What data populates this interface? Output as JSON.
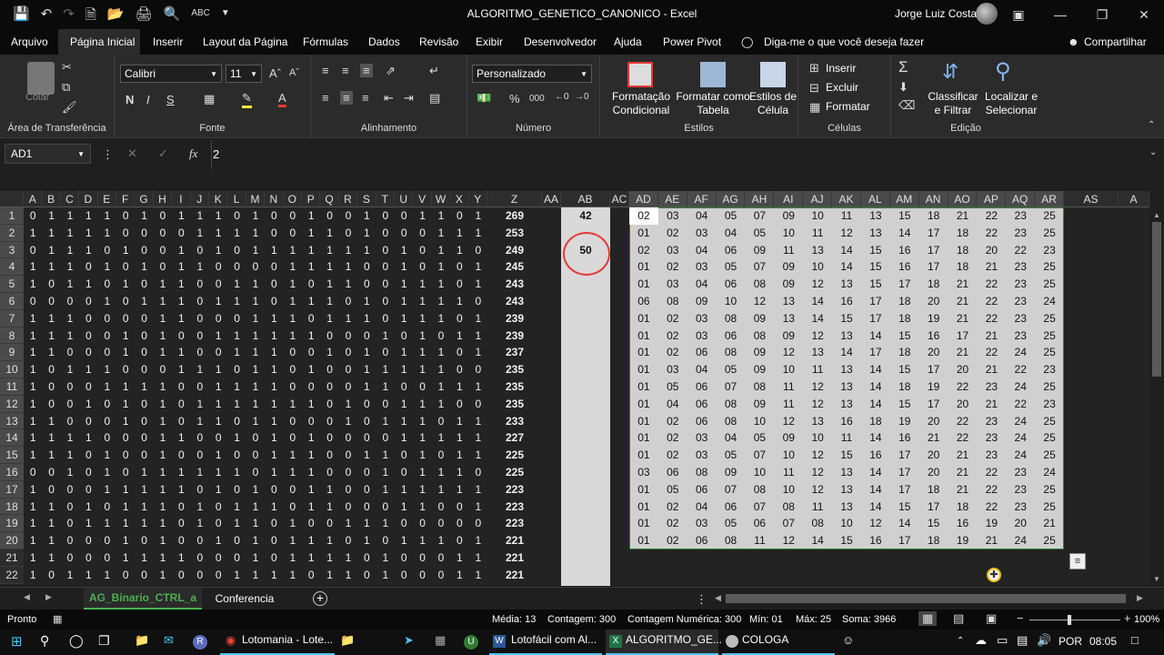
{
  "window": {
    "title": "ALGORITMO_GENETICO_CANONICO  -  Excel",
    "user": "Jorge Luiz Costa"
  },
  "menu": [
    "Arquivo",
    "Página Inicial",
    "Inserir",
    "Layout da Página",
    "Fórmulas",
    "Dados",
    "Revisão",
    "Exibir",
    "Desenvolvedor",
    "Ajuda",
    "Power Pivot"
  ],
  "tell_me": "Diga-me o que você deseja fazer",
  "share": "Compartilhar",
  "ribbon": {
    "clipboard": {
      "label": "Área de Transferência",
      "paste": "Colar"
    },
    "font": {
      "label": "Fonte",
      "name": "Calibri",
      "size": "11",
      "bold": "N",
      "italic": "I",
      "underline": "S"
    },
    "alignment": {
      "label": "Alinhamento"
    },
    "number": {
      "label": "Número",
      "format": "Personalizado",
      "percent": "%",
      "thousands": "000"
    },
    "styles": {
      "label": "Estilos",
      "cond1": "Formatação",
      "cond2": "Condicional",
      "table1": "Formatar como",
      "table2": "Tabela",
      "cell1": "Estilos de",
      "cell2": "Célula"
    },
    "cells": {
      "label": "Células",
      "insert": "Inserir",
      "delete": "Excluir",
      "format": "Formatar"
    },
    "editing": {
      "label": "Edição",
      "sort1": "Classificar",
      "sort2": "e Filtrar",
      "find1": "Localizar e",
      "find2": "Selecionar"
    }
  },
  "formula_bar": {
    "name_box": "AD1",
    "fx": "fx",
    "value": "2"
  },
  "columns_left": [
    "A",
    "B",
    "C",
    "D",
    "E",
    "F",
    "G",
    "H",
    "I",
    "J",
    "K",
    "L",
    "M",
    "N",
    "O",
    "P",
    "Q",
    "R",
    "S",
    "T",
    "U",
    "V",
    "W",
    "X",
    "Y"
  ],
  "columns_right": [
    "AD",
    "AE",
    "AF",
    "AG",
    "AH",
    "AI",
    "AJ",
    "AK",
    "AL",
    "AM",
    "AN",
    "AO",
    "AP",
    "AQ",
    "AR"
  ],
  "columns_misc": {
    "z": "Z",
    "aa": "AA",
    "ab": "AB",
    "ac": "AC",
    "as": "AS",
    "at": "A"
  },
  "ab_values": {
    "ab1": "42",
    "ab3": "50"
  },
  "rows": [
    {
      "n": "1",
      "bits": "0111101011101001001001101",
      "z": "269",
      "nums": [
        "02",
        "03",
        "04",
        "05",
        "07",
        "09",
        "10",
        "11",
        "13",
        "15",
        "18",
        "21",
        "22",
        "23",
        "25"
      ]
    },
    {
      "n": "2",
      "bits": "1111100001111001101000111",
      "z": "253",
      "nums": [
        "01",
        "02",
        "03",
        "04",
        "05",
        "10",
        "11",
        "12",
        "13",
        "14",
        "17",
        "18",
        "22",
        "23",
        "25"
      ]
    },
    {
      "n": "3",
      "bits": "0111010010101111111010110",
      "z": "249",
      "nums": [
        "02",
        "03",
        "04",
        "06",
        "09",
        "11",
        "13",
        "14",
        "15",
        "16",
        "17",
        "18",
        "20",
        "22",
        "23"
      ]
    },
    {
      "n": "4",
      "bits": "1110101011000011110010101",
      "z": "245",
      "nums": [
        "01",
        "02",
        "03",
        "05",
        "07",
        "09",
        "10",
        "14",
        "15",
        "16",
        "17",
        "18",
        "21",
        "23",
        "25"
      ]
    },
    {
      "n": "5",
      "bits": "1011010110011010110011101",
      "z": "243",
      "nums": [
        "01",
        "03",
        "04",
        "06",
        "08",
        "09",
        "12",
        "13",
        "15",
        "17",
        "18",
        "21",
        "22",
        "23",
        "25"
      ]
    },
    {
      "n": "6",
      "bits": "0000101110111011101011110",
      "z": "243",
      "nums": [
        "06",
        "08",
        "09",
        "10",
        "12",
        "13",
        "14",
        "16",
        "17",
        "18",
        "20",
        "21",
        "22",
        "23",
        "24"
      ]
    },
    {
      "n": "7",
      "bits": "1110000110001110111011101",
      "z": "239",
      "nums": [
        "01",
        "02",
        "03",
        "08",
        "09",
        "13",
        "14",
        "15",
        "17",
        "18",
        "19",
        "21",
        "22",
        "23",
        "25"
      ]
    },
    {
      "n": "8",
      "bits": "1110010100111111000101011",
      "z": "239",
      "nums": [
        "01",
        "02",
        "03",
        "06",
        "08",
        "09",
        "12",
        "13",
        "14",
        "15",
        "16",
        "17",
        "21",
        "23",
        "25"
      ]
    },
    {
      "n": "9",
      "bits": "1100010110011100101011101",
      "z": "237",
      "nums": [
        "01",
        "02",
        "06",
        "08",
        "09",
        "12",
        "13",
        "14",
        "17",
        "18",
        "20",
        "21",
        "22",
        "24",
        "25"
      ]
    },
    {
      "n": "10",
      "bits": "1011100011101101001111100",
      "z": "235",
      "nums": [
        "01",
        "03",
        "04",
        "05",
        "09",
        "10",
        "11",
        "13",
        "14",
        "15",
        "17",
        "20",
        "21",
        "22",
        "23"
      ]
    },
    {
      "n": "11",
      "bits": "1000111100111100001100111",
      "z": "235",
      "nums": [
        "01",
        "05",
        "06",
        "07",
        "08",
        "11",
        "12",
        "13",
        "14",
        "18",
        "19",
        "22",
        "23",
        "24",
        "25"
      ]
    },
    {
      "n": "12",
      "bits": "1001010101111111010011100",
      "z": "235",
      "nums": [
        "01",
        "04",
        "06",
        "08",
        "09",
        "11",
        "12",
        "13",
        "14",
        "15",
        "17",
        "20",
        "21",
        "22",
        "23"
      ]
    },
    {
      "n": "13",
      "bits": "1100010101101100010111011",
      "z": "233",
      "nums": [
        "01",
        "02",
        "06",
        "08",
        "10",
        "12",
        "13",
        "16",
        "18",
        "19",
        "20",
        "22",
        "23",
        "24",
        "25"
      ]
    },
    {
      "n": "14",
      "bits": "1111000110010101000011111",
      "z": "227",
      "nums": [
        "01",
        "02",
        "03",
        "04",
        "05",
        "09",
        "10",
        "11",
        "14",
        "16",
        "21",
        "22",
        "23",
        "24",
        "25"
      ]
    },
    {
      "n": "15",
      "bits": "1110100100100111001101011",
      "z": "225",
      "nums": [
        "01",
        "02",
        "03",
        "05",
        "07",
        "10",
        "12",
        "15",
        "16",
        "17",
        "20",
        "21",
        "23",
        "24",
        "25"
      ]
    },
    {
      "n": "16",
      "bits": "0010101111110111000101110",
      "z": "225",
      "nums": [
        "03",
        "06",
        "08",
        "09",
        "10",
        "11",
        "12",
        "13",
        "14",
        "17",
        "20",
        "21",
        "22",
        "23",
        "24"
      ]
    },
    {
      "n": "17",
      "bits": "1000111110101001100111111",
      "z": "223",
      "nums": [
        "01",
        "05",
        "06",
        "07",
        "08",
        "10",
        "12",
        "13",
        "14",
        "17",
        "18",
        "21",
        "22",
        "23",
        "25"
      ]
    },
    {
      "n": "18",
      "bits": "1101011101011101100011001",
      "z": "223",
      "nums": [
        "01",
        "02",
        "04",
        "06",
        "07",
        "08",
        "11",
        "13",
        "14",
        "15",
        "17",
        "18",
        "22",
        "23",
        "25"
      ]
    },
    {
      "n": "19",
      "bits": "1101111101011010011100000",
      "z": "223",
      "nums": [
        "01",
        "02",
        "03",
        "05",
        "06",
        "07",
        "08",
        "10",
        "12",
        "14",
        "15",
        "16",
        "19",
        "20",
        "21"
      ]
    },
    {
      "n": "20",
      "bits": "1100010100101011101011101",
      "z": "221",
      "nums": [
        "01",
        "02",
        "06",
        "08",
        "11",
        "12",
        "14",
        "15",
        "16",
        "17",
        "18",
        "19",
        "21",
        "24",
        "25"
      ]
    },
    {
      "n": "21",
      "bits": "1100011110001011110100011",
      "z": "221",
      "nums": []
    },
    {
      "n": "22",
      "bits": "1011100100011110110100011",
      "z": "221",
      "nums": []
    }
  ],
  "sheets": {
    "active": "AG_Binario_CTRL_a",
    "other": "Conferencia"
  },
  "status": {
    "ready": "Pronto",
    "avg": "Média: 13",
    "count": "Contagem: 300",
    "numcount": "Contagem Numérica: 300",
    "min": "Mín: 01",
    "max": "Máx: 25",
    "sum": "Soma: 3966",
    "zoom": "100%"
  },
  "taskbar": {
    "app1": "Lotomania - Lote...",
    "app2": "Lotofácil com Al...",
    "app3": "ALGORITMO_GE...",
    "app4": "COLOGA",
    "lang": "POR",
    "time": "08:05"
  }
}
